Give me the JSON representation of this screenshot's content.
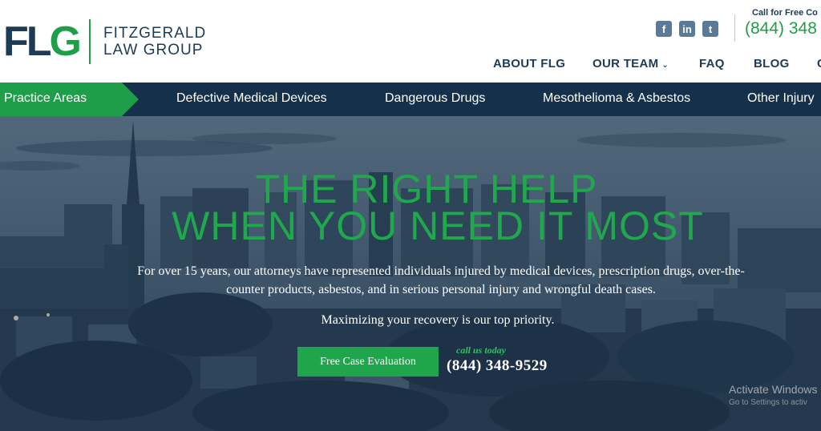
{
  "header": {
    "logo_mark_a": "FL",
    "logo_mark_b": "G",
    "logo_line1": "FITZGERALD",
    "logo_line2": "LAW GROUP",
    "social": [
      {
        "icon": "facebook-icon",
        "glyph": "f"
      },
      {
        "icon": "linkedin-icon",
        "glyph": "in"
      },
      {
        "icon": "twitter-icon",
        "glyph": "t"
      }
    ],
    "call_label": "Call for Free Co",
    "call_phone": "(844) 348",
    "nav": [
      {
        "label": "ABOUT FLG"
      },
      {
        "label": "OUR TEAM",
        "caret": "⌄"
      },
      {
        "label": "FAQ"
      },
      {
        "label": "BLOG"
      },
      {
        "label": "C"
      }
    ]
  },
  "practice_bar": {
    "tab_label": "Practice Areas",
    "items": [
      "Defective Medical Devices",
      "Dangerous Drugs",
      "Mesothelioma & Asbestos",
      "Other Injury"
    ]
  },
  "hero": {
    "headline_line1": "THE RIGHT HELP",
    "headline_line2": "WHEN YOU NEED IT MOST",
    "description": "For over 15 years, our attorneys have represented individuals injured by medical devices, prescription drugs, over-the-counter products, asbestos, and in serious personal injury and wrongful death cases.",
    "tagline": "Maximizing your recovery is our top priority.",
    "cta_label": "Free Case Evaluation",
    "call_us": "call us today",
    "phone": "(844) 348-9529"
  },
  "watermark": {
    "title": "Activate Windows",
    "subtitle": "Go to Settings to activ"
  },
  "colors": {
    "navy": "#1d3a57",
    "bar": "#15304a",
    "green": "#1f9e4a",
    "headline_green": "#20a84c"
  }
}
